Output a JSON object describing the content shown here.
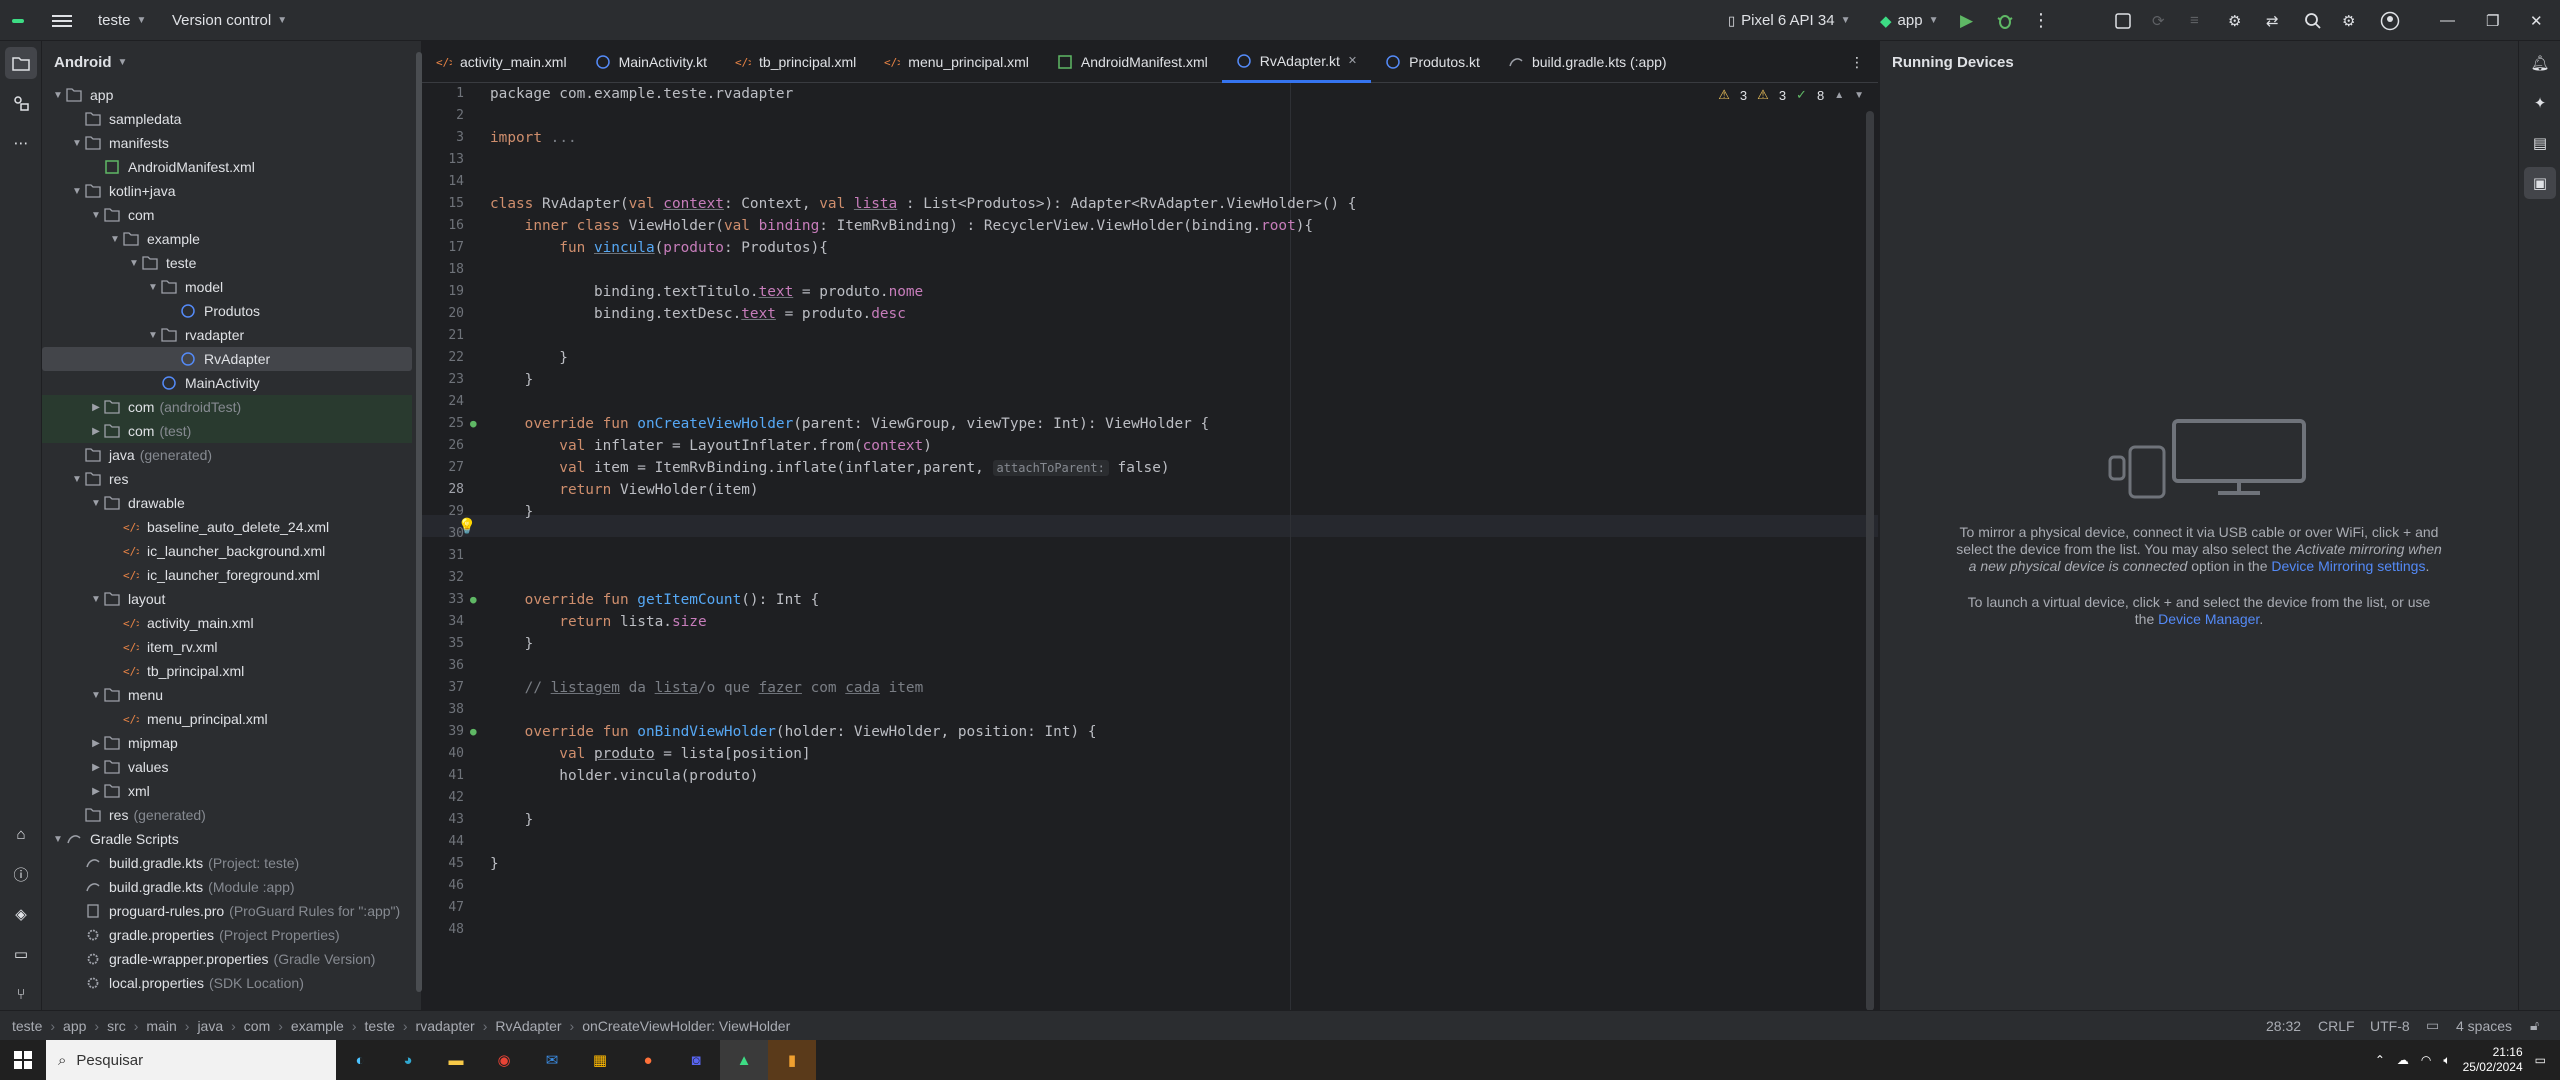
{
  "titlebar": {
    "project": "teste",
    "vcs": "Version control",
    "device": "Pixel 6 API 34",
    "run_config": "app"
  },
  "project_panel": {
    "view": "Android",
    "tree": [
      {
        "label": "app",
        "depth": 0,
        "arrow": "v",
        "icon": "folder"
      },
      {
        "label": "sampledata",
        "depth": 1,
        "arrow": "",
        "icon": "folder"
      },
      {
        "label": "manifests",
        "depth": 1,
        "arrow": "v",
        "icon": "folder"
      },
      {
        "label": "AndroidManifest.xml",
        "depth": 2,
        "arrow": "",
        "icon": "manifest"
      },
      {
        "label": "kotlin+java",
        "depth": 1,
        "arrow": "v",
        "icon": "folder"
      },
      {
        "label": "com",
        "depth": 2,
        "arrow": "v",
        "icon": "folder"
      },
      {
        "label": "example",
        "depth": 3,
        "arrow": "v",
        "icon": "folder"
      },
      {
        "label": "teste",
        "depth": 4,
        "arrow": "v",
        "icon": "folder"
      },
      {
        "label": "model",
        "depth": 5,
        "arrow": "v",
        "icon": "folder"
      },
      {
        "label": "Produtos",
        "depth": 6,
        "arrow": "",
        "icon": "kotlin"
      },
      {
        "label": "rvadapter",
        "depth": 5,
        "arrow": "v",
        "icon": "folder"
      },
      {
        "label": "RvAdapter",
        "depth": 6,
        "arrow": "",
        "icon": "kotlin",
        "selected": true
      },
      {
        "label": "MainActivity",
        "depth": 5,
        "arrow": "",
        "icon": "kotlin"
      },
      {
        "label": "com",
        "extra": "(androidTest)",
        "depth": 2,
        "arrow": ">",
        "icon": "folder",
        "hl": true
      },
      {
        "label": "com",
        "extra": "(test)",
        "depth": 2,
        "arrow": ">",
        "icon": "folder",
        "hl": true
      },
      {
        "label": "java",
        "extra": "(generated)",
        "depth": 1,
        "arrow": "",
        "icon": "folder"
      },
      {
        "label": "res",
        "depth": 1,
        "arrow": "v",
        "icon": "folder"
      },
      {
        "label": "drawable",
        "depth": 2,
        "arrow": "v",
        "icon": "folder"
      },
      {
        "label": "baseline_auto_delete_24.xml",
        "depth": 3,
        "arrow": "",
        "icon": "xml"
      },
      {
        "label": "ic_launcher_background.xml",
        "depth": 3,
        "arrow": "",
        "icon": "xml"
      },
      {
        "label": "ic_launcher_foreground.xml",
        "depth": 3,
        "arrow": "",
        "icon": "xml"
      },
      {
        "label": "layout",
        "depth": 2,
        "arrow": "v",
        "icon": "folder"
      },
      {
        "label": "activity_main.xml",
        "depth": 3,
        "arrow": "",
        "icon": "xml"
      },
      {
        "label": "item_rv.xml",
        "depth": 3,
        "arrow": "",
        "icon": "xml"
      },
      {
        "label": "tb_principal.xml",
        "depth": 3,
        "arrow": "",
        "icon": "xml"
      },
      {
        "label": "menu",
        "depth": 2,
        "arrow": "v",
        "icon": "folder"
      },
      {
        "label": "menu_principal.xml",
        "depth": 3,
        "arrow": "",
        "icon": "xml"
      },
      {
        "label": "mipmap",
        "depth": 2,
        "arrow": ">",
        "icon": "folder"
      },
      {
        "label": "values",
        "depth": 2,
        "arrow": ">",
        "icon": "folder"
      },
      {
        "label": "xml",
        "depth": 2,
        "arrow": ">",
        "icon": "folder"
      },
      {
        "label": "res",
        "extra": "(generated)",
        "depth": 1,
        "arrow": "",
        "icon": "folder"
      },
      {
        "label": "Gradle Scripts",
        "depth": 0,
        "arrow": "v",
        "icon": "gradle"
      },
      {
        "label": "build.gradle.kts",
        "extra": "(Project: teste)",
        "depth": 1,
        "arrow": "",
        "icon": "gradle"
      },
      {
        "label": "build.gradle.kts",
        "extra": "(Module :app)",
        "depth": 1,
        "arrow": "",
        "icon": "gradle"
      },
      {
        "label": "proguard-rules.pro",
        "extra": "(ProGuard Rules for \":app\")",
        "depth": 1,
        "arrow": "",
        "icon": "file"
      },
      {
        "label": "gradle.properties",
        "extra": "(Project Properties)",
        "depth": 1,
        "arrow": "",
        "icon": "gear"
      },
      {
        "label": "gradle-wrapper.properties",
        "extra": "(Gradle Version)",
        "depth": 1,
        "arrow": "",
        "icon": "gear"
      },
      {
        "label": "local.properties",
        "extra": "(SDK Location)",
        "depth": 1,
        "arrow": "",
        "icon": "gear"
      }
    ]
  },
  "tabs": [
    {
      "label": "activity_main.xml",
      "icon": "xml"
    },
    {
      "label": "MainActivity.kt",
      "icon": "kotlin"
    },
    {
      "label": "tb_principal.xml",
      "icon": "xml"
    },
    {
      "label": "menu_principal.xml",
      "icon": "xml"
    },
    {
      "label": "AndroidManifest.xml",
      "icon": "manifest"
    },
    {
      "label": "RvAdapter.kt",
      "icon": "kotlin",
      "active": true
    },
    {
      "label": "Produtos.kt",
      "icon": "kotlin"
    },
    {
      "label": "build.gradle.kts (:app)",
      "icon": "gradle"
    }
  ],
  "inspections": {
    "warnings": "3",
    "weak": "3",
    "ok": "8"
  },
  "editor": {
    "current_line": "28",
    "lines": [
      {
        "n": "1",
        "c": [
          [
            "package com.example.teste.rvadapter",
            ""
          ]
        ]
      },
      {
        "n": "2",
        "c": []
      },
      {
        "n": "3",
        "c": [
          [
            "import ",
            "kw"
          ],
          [
            "...",
            "cm"
          ]
        ]
      },
      {
        "n": "13",
        "c": []
      },
      {
        "n": "14",
        "c": []
      },
      {
        "n": "15",
        "c": [
          [
            "class ",
            "kw"
          ],
          [
            "RvAdapter(",
            ""
          ],
          [
            "val ",
            "kw"
          ],
          [
            "context",
            "pr us"
          ],
          [
            ": Context, ",
            ""
          ],
          [
            "val ",
            "kw"
          ],
          [
            "lista",
            "pr us"
          ],
          [
            " : List<Produtos>): Adapter<RvAdapter.ViewHolder>() {",
            ""
          ]
        ]
      },
      {
        "n": "16",
        "c": [
          [
            "    inner class ",
            "kw"
          ],
          [
            "ViewHolder(",
            ""
          ],
          [
            "val ",
            "kw"
          ],
          [
            "binding",
            "pr"
          ],
          [
            ": ItemRvBinding) : RecyclerView.ViewHolder(binding.",
            ""
          ],
          [
            "root",
            "pr"
          ],
          [
            "){",
            ""
          ]
        ]
      },
      {
        "n": "17",
        "c": [
          [
            "        fun ",
            "kw"
          ],
          [
            "vincula",
            "fn us"
          ],
          [
            "(",
            ""
          ],
          [
            "produto",
            "pr"
          ],
          [
            ": Produtos){",
            ""
          ]
        ]
      },
      {
        "n": "18",
        "c": []
      },
      {
        "n": "19",
        "c": [
          [
            "            binding.textTitulo.",
            ""
          ],
          [
            "text",
            "pr us"
          ],
          [
            " = produto.",
            ""
          ],
          [
            "nome",
            "pr"
          ]
        ]
      },
      {
        "n": "20",
        "c": [
          [
            "            binding.textDesc.",
            ""
          ],
          [
            "text",
            "pr us"
          ],
          [
            " = produto.",
            ""
          ],
          [
            "desc",
            "pr"
          ]
        ]
      },
      {
        "n": "21",
        "c": []
      },
      {
        "n": "22",
        "c": [
          [
            "        }",
            ""
          ]
        ]
      },
      {
        "n": "23",
        "c": [
          [
            "    }",
            ""
          ]
        ]
      },
      {
        "n": "24",
        "c": []
      },
      {
        "n": "25",
        "c": [
          [
            "    override fun ",
            "kw"
          ],
          [
            "onCreateViewHolder",
            "fn"
          ],
          [
            "(parent: ViewGroup, viewType: Int): ViewHolder {",
            ""
          ]
        ]
      },
      {
        "n": "26",
        "c": [
          [
            "        val ",
            "kw"
          ],
          [
            "inflater = LayoutInflater.from(",
            ""
          ],
          [
            "context",
            "pr"
          ],
          [
            ")",
            ""
          ]
        ]
      },
      {
        "n": "27",
        "c": [
          [
            "        val ",
            "kw"
          ],
          [
            "item = ItemRvBinding.inflate(inflater,parent, ",
            ""
          ],
          [
            "attachToParent:",
            "hint"
          ],
          [
            " false)",
            ""
          ]
        ]
      },
      {
        "n": "28",
        "c": [
          [
            "        return ",
            "kw"
          ],
          [
            "ViewHolder(item)",
            ""
          ]
        ]
      },
      {
        "n": "29",
        "c": [
          [
            "    }",
            ""
          ]
        ]
      },
      {
        "n": "30",
        "c": []
      },
      {
        "n": "31",
        "c": []
      },
      {
        "n": "32",
        "c": []
      },
      {
        "n": "33",
        "c": [
          [
            "    override fun ",
            "kw"
          ],
          [
            "getItemCount",
            "fn"
          ],
          [
            "(): Int {",
            ""
          ]
        ]
      },
      {
        "n": "34",
        "c": [
          [
            "        return ",
            "kw"
          ],
          [
            "lista.",
            ""
          ],
          [
            "size",
            "pr"
          ]
        ]
      },
      {
        "n": "35",
        "c": [
          [
            "    }",
            ""
          ]
        ]
      },
      {
        "n": "36",
        "c": []
      },
      {
        "n": "37",
        "c": [
          [
            "    // ",
            "cm"
          ],
          [
            "listagem",
            "cm us"
          ],
          [
            " da ",
            "cm"
          ],
          [
            "lista",
            "cm us"
          ],
          [
            "/o que ",
            "cm"
          ],
          [
            "fazer",
            "cm us"
          ],
          [
            " com ",
            "cm"
          ],
          [
            "cada",
            "cm us"
          ],
          [
            " item",
            "cm"
          ]
        ]
      },
      {
        "n": "38",
        "c": []
      },
      {
        "n": "39",
        "c": [
          [
            "    override fun ",
            "kw"
          ],
          [
            "onBindViewHolder",
            "fn"
          ],
          [
            "(holder: ViewHolder, position: Int) {",
            ""
          ]
        ]
      },
      {
        "n": "40",
        "c": [
          [
            "        val ",
            "kw"
          ],
          [
            "produto",
            "us"
          ],
          [
            " = lista[position]",
            ""
          ]
        ]
      },
      {
        "n": "41",
        "c": [
          [
            "        holder.vincula(produto)",
            ""
          ]
        ]
      },
      {
        "n": "42",
        "c": []
      },
      {
        "n": "43",
        "c": [
          [
            "    }",
            ""
          ]
        ]
      },
      {
        "n": "44",
        "c": []
      },
      {
        "n": "45",
        "c": [
          [
            "}",
            ""
          ]
        ]
      },
      {
        "n": "46",
        "c": []
      },
      {
        "n": "47",
        "c": []
      },
      {
        "n": "48",
        "c": []
      }
    ]
  },
  "running_devices": {
    "title": "Running Devices",
    "msg1_a": "To mirror a physical device, connect it via USB cable or over WiFi, click",
    "msg1_b": "and",
    "msg1_c": "select the device from the list. You may also select the",
    "msg1_d": "Activate mirroring when",
    "msg1_e": "a new physical device is connected",
    "msg1_f": "option in the",
    "msg1_link": "Device Mirroring settings",
    "msg2_a": "To launch a virtual device, click",
    "msg2_b": "and select the device from the list, or use",
    "msg2_c": "the",
    "msg2_link": "Device Manager"
  },
  "statusbar": {
    "breadcrumb": [
      "teste",
      "app",
      "src",
      "main",
      "java",
      "com",
      "example",
      "teste",
      "rvadapter",
      "RvAdapter",
      "onCreateViewHolder: ViewHolder"
    ],
    "position": "28:32",
    "line_sep": "CRLF",
    "encoding": "UTF-8",
    "indent": "4 spaces"
  },
  "taskbar": {
    "search_placeholder": "Pesquisar",
    "time": "21:16",
    "date": "25/02/2024"
  },
  "colors": {
    "accent": "#3574f0",
    "keyword": "#cf8e6d",
    "function": "#56a8f5",
    "property": "#c77dbb",
    "comment": "#7a7e85"
  }
}
